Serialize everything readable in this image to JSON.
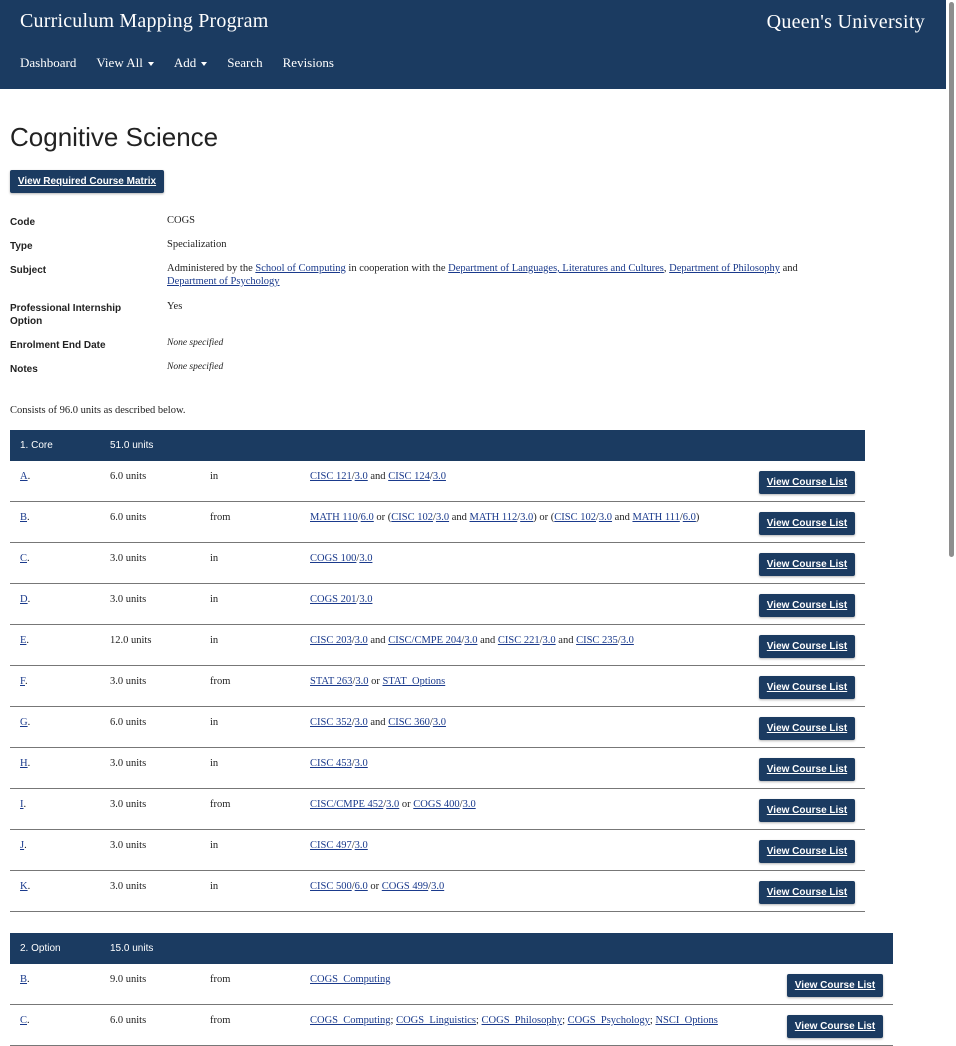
{
  "header": {
    "brand": "Curriculum Mapping Program",
    "institution": "Queen's University",
    "nav": [
      {
        "label": "Dashboard",
        "dropdown": false
      },
      {
        "label": "View All",
        "dropdown": true
      },
      {
        "label": "Add",
        "dropdown": true
      },
      {
        "label": "Search",
        "dropdown": false
      },
      {
        "label": "Revisions",
        "dropdown": false
      }
    ]
  },
  "page": {
    "title": "Cognitive Science",
    "matrix_button": "View Required Course Matrix",
    "consists": "Consists of 96.0 units as described below."
  },
  "meta": {
    "code_label": "Code",
    "code": "COGS",
    "type_label": "Type",
    "type": "Specialization",
    "subject_label": "Subject",
    "subject_text1": "Administered by the ",
    "subject_link1": "School of Computing",
    "subject_text2": " in cooperation with the ",
    "subject_link2": "Department of Languages, Literatures and Cultures",
    "subject_sep": ", ",
    "subject_link3": "Department of Philosophy",
    "subject_and": " and",
    "subject_link4": "Department of Psychology",
    "internship_label1": "Professional Internship",
    "internship_label2": "Option",
    "internship": "Yes",
    "enrolment_label": "Enrolment End Date",
    "enrolment": "None specified",
    "notes_label": "Notes",
    "notes": "None specified"
  },
  "button_label": "View Course List",
  "groups": [
    {
      "number": "1. Core",
      "units": "51.0 units",
      "rows": [
        {
          "letter": "A",
          "units": "6.0 units",
          "prep": "in",
          "desc": [
            [
              "CISC 121",
              "/",
              "3.0"
            ],
            " and ",
            [
              "CISC 124",
              "/",
              "3.0"
            ]
          ]
        },
        {
          "letter": "B",
          "units": "6.0 units",
          "prep": "from",
          "desc": [
            [
              "MATH 110",
              "/",
              "6.0"
            ],
            " or (",
            [
              "CISC 102",
              "/",
              "3.0"
            ],
            " and ",
            [
              "MATH 112",
              "/",
              "3.0"
            ],
            ") or (",
            [
              "CISC 102",
              "/",
              "3.0"
            ],
            " and ",
            [
              "MATH 111",
              "/",
              "6.0"
            ],
            ")"
          ]
        },
        {
          "letter": "C",
          "units": "3.0 units",
          "prep": "in",
          "desc": [
            [
              "COGS 100",
              "/",
              "3.0"
            ]
          ]
        },
        {
          "letter": "D",
          "units": "3.0 units",
          "prep": "in",
          "desc": [
            [
              "COGS 201",
              "/",
              "3.0"
            ]
          ]
        },
        {
          "letter": "E",
          "units": "12.0 units",
          "prep": "in",
          "desc": [
            [
              "CISC 203",
              "/",
              "3.0"
            ],
            " and ",
            [
              "CISC/CMPE 204",
              "/",
              "3.0"
            ],
            " and ",
            [
              "CISC 221",
              "/",
              "3.0"
            ],
            " and ",
            [
              "CISC 235",
              "/",
              "3.0"
            ]
          ]
        },
        {
          "letter": "F",
          "units": "3.0 units",
          "prep": "from",
          "desc": [
            [
              "STAT 263",
              "/",
              "3.0"
            ],
            " or ",
            [
              "STAT_Options"
            ]
          ]
        },
        {
          "letter": "G",
          "units": "6.0 units",
          "prep": "in",
          "desc": [
            [
              "CISC 352",
              "/",
              "3.0"
            ],
            " and ",
            [
              "CISC 360",
              "/",
              "3.0"
            ]
          ]
        },
        {
          "letter": "H",
          "units": "3.0 units",
          "prep": "in",
          "desc": [
            [
              "CISC 453",
              "/",
              "3.0"
            ]
          ]
        },
        {
          "letter": "I",
          "units": "3.0 units",
          "prep": "from",
          "desc": [
            [
              "CISC/CMPE 452",
              "/",
              "3.0"
            ],
            " or ",
            [
              "COGS 400",
              "/",
              "3.0"
            ]
          ]
        },
        {
          "letter": "J",
          "units": "3.0 units",
          "prep": "in",
          "desc": [
            [
              "CISC 497",
              "/",
              "3.0"
            ]
          ]
        },
        {
          "letter": "K",
          "units": "3.0 units",
          "prep": "in",
          "desc": [
            [
              "CISC 500",
              "/",
              "6.0"
            ],
            " or ",
            [
              "COGS 499",
              "/",
              "3.0"
            ]
          ]
        }
      ]
    },
    {
      "number": "2. Option",
      "units": "15.0 units",
      "rows": [
        {
          "letter": "B",
          "units": "9.0 units",
          "prep": "from",
          "desc": [
            [
              "COGS_Computing"
            ]
          ]
        },
        {
          "letter": "C",
          "units": "6.0 units",
          "prep": "from",
          "desc": [
            [
              "COGS_Computing"
            ],
            "; ",
            [
              "COGS_Linguistics"
            ],
            "; ",
            [
              "COGS_Philosophy"
            ],
            "; ",
            [
              "COGS_Psychology"
            ],
            "; ",
            [
              "NSCI_Options"
            ]
          ]
        }
      ]
    }
  ]
}
